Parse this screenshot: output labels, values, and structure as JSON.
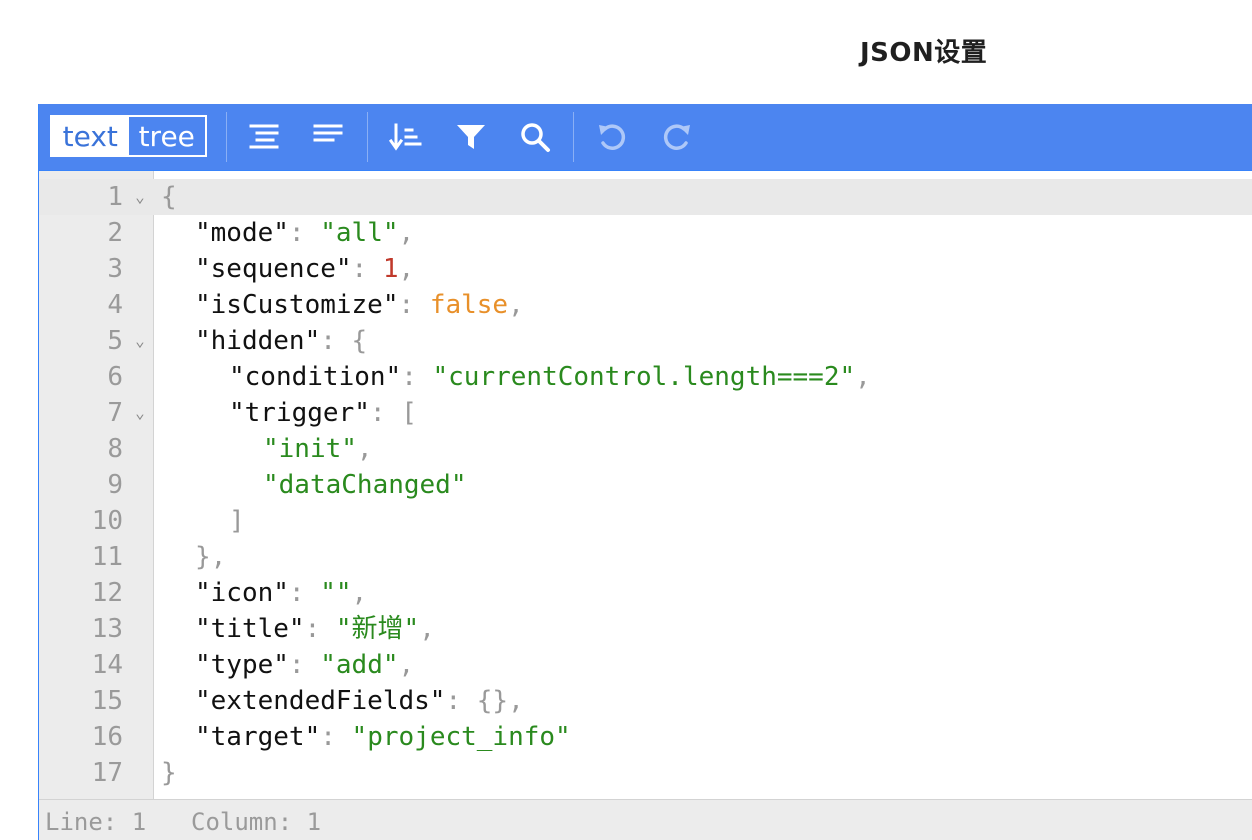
{
  "page": {
    "title": "JSON设置"
  },
  "toolbar": {
    "mode_text_label": "text",
    "mode_tree_label": "tree",
    "tools": [
      {
        "name": "format-icon"
      },
      {
        "name": "compact-icon"
      },
      {
        "name": "sort-icon"
      },
      {
        "name": "filter-icon"
      },
      {
        "name": "search-icon"
      },
      {
        "name": "undo-icon",
        "disabled": true
      },
      {
        "name": "redo-icon",
        "disabled": true
      }
    ],
    "color": "#4c85f0"
  },
  "editor": {
    "lines": [
      {
        "n": "1",
        "fold": true,
        "tokens": [
          [
            "p",
            "{"
          ]
        ]
      },
      {
        "n": "2",
        "indent": 1,
        "tokens": [
          [
            "k",
            "\"mode\""
          ],
          [
            "p",
            ": "
          ],
          [
            "s",
            "\"all\""
          ],
          [
            "p",
            ","
          ]
        ]
      },
      {
        "n": "3",
        "indent": 1,
        "tokens": [
          [
            "k",
            "\"sequence\""
          ],
          [
            "p",
            ": "
          ],
          [
            "n",
            "1"
          ],
          [
            "p",
            ","
          ]
        ]
      },
      {
        "n": "4",
        "indent": 1,
        "tokens": [
          [
            "k",
            "\"isCustomize\""
          ],
          [
            "p",
            ": "
          ],
          [
            "b",
            "false"
          ],
          [
            "p",
            ","
          ]
        ]
      },
      {
        "n": "5",
        "fold": true,
        "indent": 1,
        "tokens": [
          [
            "k",
            "\"hidden\""
          ],
          [
            "p",
            ": "
          ],
          [
            "p",
            "{"
          ]
        ]
      },
      {
        "n": "6",
        "indent": 2,
        "tokens": [
          [
            "k",
            "\"condition\""
          ],
          [
            "p",
            ": "
          ],
          [
            "s",
            "\"currentControl.length===2\""
          ],
          [
            "p",
            ","
          ]
        ]
      },
      {
        "n": "7",
        "fold": true,
        "indent": 2,
        "tokens": [
          [
            "k",
            "\"trigger\""
          ],
          [
            "p",
            ": "
          ],
          [
            "p",
            "["
          ]
        ]
      },
      {
        "n": "8",
        "indent": 3,
        "tokens": [
          [
            "s",
            "\"init\""
          ],
          [
            "p",
            ","
          ]
        ]
      },
      {
        "n": "9",
        "indent": 3,
        "tokens": [
          [
            "s",
            "\"dataChanged\""
          ]
        ]
      },
      {
        "n": "10",
        "indent": 2,
        "tokens": [
          [
            "p",
            "]"
          ]
        ]
      },
      {
        "n": "11",
        "indent": 1,
        "tokens": [
          [
            "p",
            "},"
          ]
        ]
      },
      {
        "n": "12",
        "indent": 1,
        "tokens": [
          [
            "k",
            "\"icon\""
          ],
          [
            "p",
            ": "
          ],
          [
            "s",
            "\"\""
          ],
          [
            "p",
            ","
          ]
        ]
      },
      {
        "n": "13",
        "indent": 1,
        "tokens": [
          [
            "k",
            "\"title\""
          ],
          [
            "p",
            ": "
          ],
          [
            "s",
            "\"新增\""
          ],
          [
            "p",
            ","
          ]
        ]
      },
      {
        "n": "14",
        "indent": 1,
        "tokens": [
          [
            "k",
            "\"type\""
          ],
          [
            "p",
            ": "
          ],
          [
            "s",
            "\"add\""
          ],
          [
            "p",
            ","
          ]
        ]
      },
      {
        "n": "15",
        "indent": 1,
        "tokens": [
          [
            "k",
            "\"extendedFields\""
          ],
          [
            "p",
            ": "
          ],
          [
            "p",
            "{}"
          ],
          [
            "p",
            ","
          ]
        ]
      },
      {
        "n": "16",
        "indent": 1,
        "tokens": [
          [
            "k",
            "\"target\""
          ],
          [
            "p",
            ": "
          ],
          [
            "s",
            "\"project_info\""
          ]
        ]
      },
      {
        "n": "17",
        "tokens": [
          [
            "p",
            "}"
          ]
        ]
      }
    ],
    "fold_glyph": "⌄"
  },
  "status": {
    "line_label": "Line: 1",
    "column_label": "Column: 1"
  }
}
